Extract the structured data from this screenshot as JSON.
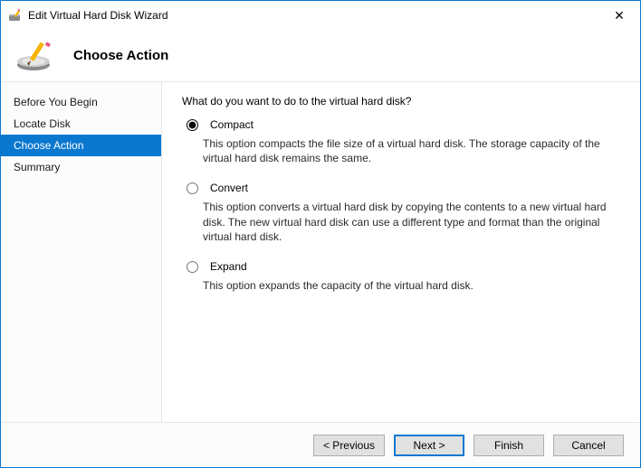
{
  "window": {
    "title": "Edit Virtual Hard Disk Wizard"
  },
  "header": {
    "title": "Choose Action"
  },
  "sidebar": {
    "steps": [
      {
        "label": "Before You Begin"
      },
      {
        "label": "Locate Disk"
      },
      {
        "label": "Choose Action"
      },
      {
        "label": "Summary"
      }
    ],
    "active_index": 2
  },
  "content": {
    "question": "What do you want to do to the virtual hard disk?",
    "options": [
      {
        "label": "Compact",
        "description": "This option compacts the file size of a virtual hard disk. The storage capacity of the virtual hard disk remains the same.",
        "selected": true
      },
      {
        "label": "Convert",
        "description": "This option converts a virtual hard disk by copying the contents to a new virtual hard disk. The new virtual hard disk can use a different type and format than the original virtual hard disk.",
        "selected": false
      },
      {
        "label": "Expand",
        "description": "This option expands the capacity of the virtual hard disk.",
        "selected": false
      }
    ]
  },
  "footer": {
    "previous": "< Previous",
    "next": "Next >",
    "finish": "Finish",
    "cancel": "Cancel"
  }
}
